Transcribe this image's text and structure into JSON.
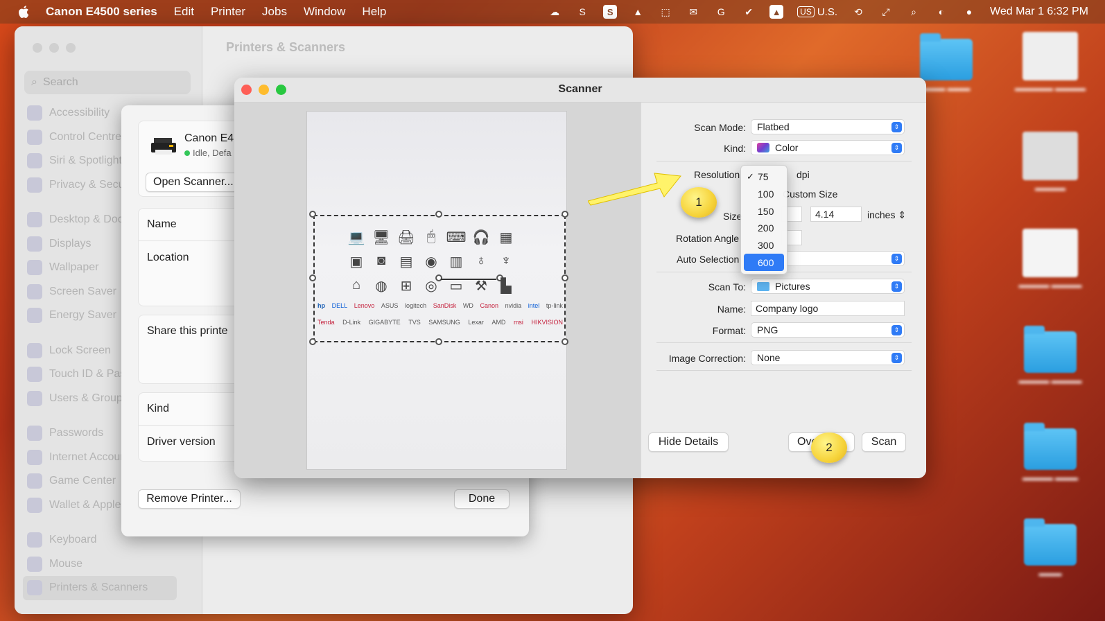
{
  "menubar": {
    "app_name": "Canon E4500 series",
    "items": [
      "Edit",
      "Printer",
      "Jobs",
      "Window",
      "Help"
    ],
    "input_source": "U.S.",
    "input_badge": "US",
    "datetime": "Wed Mar 1  6:32 PM"
  },
  "settings": {
    "title": "Printers & Scanners",
    "search_placeholder": "Search",
    "sidebar": [
      "Accessibility",
      "Control Centre",
      "Siri & Spotlight",
      "Privacy & Security",
      "Desktop & Dock",
      "Displays",
      "Wallpaper",
      "Screen Saver",
      "Energy Saver",
      "Lock Screen",
      "Touch ID & Password",
      "Users & Groups",
      "Passwords",
      "Internet Accounts",
      "Game Center",
      "Wallet & Apple Pay",
      "Keyboard",
      "Mouse",
      "Printers & Scanners"
    ]
  },
  "printer_sheet": {
    "printer_name": "Canon E4",
    "printer_status": "Idle, Defa",
    "open_scanner": "Open Scanner...",
    "rows": {
      "name": "Name",
      "location": "Location",
      "share": "Share this printe",
      "kind": "Kind",
      "driver": "Driver version"
    },
    "remove_button": "Remove Printer...",
    "done_button": "Done"
  },
  "scanner": {
    "title": "Scanner",
    "scan_mode_label": "Scan Mode:",
    "scan_mode_value": "Flatbed",
    "kind_label": "Kind:",
    "kind_value": "Color",
    "resolution_label": "Resolution",
    "resolution_unit": "dpi",
    "custom_size": "Custom Size",
    "size_label": "Size",
    "size_height": "4.14",
    "size_unit": "inches",
    "rotation_label": "Rotation Angle",
    "auto_selection_label": "Auto Selection",
    "scan_to_label": "Scan To:",
    "scan_to_value": "Pictures",
    "name_label": "Name:",
    "name_value": "Company logo",
    "format_label": "Format:",
    "format_value": "PNG",
    "image_correction_label": "Image Correction:",
    "image_correction_value": "None",
    "hide_details": "Hide Details",
    "overview": "Ove",
    "scan": "Scan",
    "resolution_options": [
      "75",
      "100",
      "150",
      "200",
      "300",
      "600"
    ],
    "resolution_checked": "75",
    "resolution_highlighted": "600",
    "preview_logos_row1": [
      "hp",
      "DELL",
      "Lenovo",
      "ASUS",
      "logitech",
      "SanDisk",
      "WD",
      "Canon",
      "nvidia",
      "intel",
      "tp-link"
    ],
    "preview_logos_row2": [
      "Tenda",
      "D-Link",
      "GIGABYTE",
      "TVS",
      "SAMSUNG",
      "Lexar",
      "AMD",
      "msi",
      "HIKVISION"
    ]
  },
  "annotations": {
    "step1": "1",
    "step2": "2"
  },
  "colors": {
    "accent": "#2f7bf6",
    "callout": "#f6d33a",
    "close": "#fe5f57",
    "minimize": "#febc2e",
    "zoom": "#28c840"
  }
}
